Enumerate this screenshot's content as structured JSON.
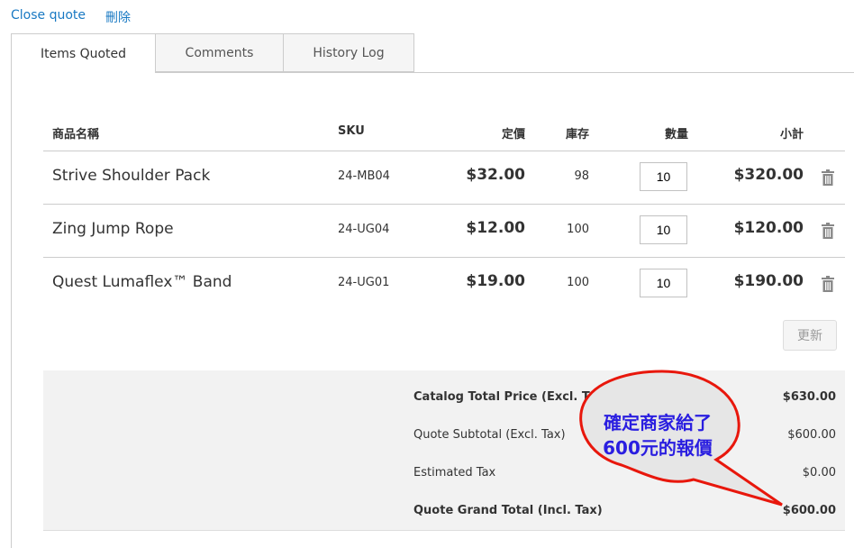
{
  "actions": {
    "close_quote": "Close quote",
    "delete": "刪除"
  },
  "tabs": [
    {
      "label": "Items Quoted",
      "active": true
    },
    {
      "label": "Comments"
    },
    {
      "label": "History Log"
    }
  ],
  "table": {
    "headers": [
      "商品名稱",
      "SKU",
      "定價",
      "庫存",
      "數量",
      "小計"
    ],
    "rows": [
      {
        "name": "Strive Shoulder Pack",
        "sku": "24-MB04",
        "price": "$32.00",
        "stock": "98",
        "qty": "10",
        "subtotal": "$320.00"
      },
      {
        "name": "Zing Jump Rope",
        "sku": "24-UG04",
        "price": "$12.00",
        "stock": "100",
        "qty": "10",
        "subtotal": "$120.00"
      },
      {
        "name": "Quest Lumaflex™ Band",
        "sku": "24-UG01",
        "price": "$19.00",
        "stock": "100",
        "qty": "10",
        "subtotal": "$190.00"
      }
    ],
    "update_label": "更新",
    "row_icon": "trash-icon"
  },
  "totals": [
    {
      "label": "Catalog Total Price (Excl. Tax)",
      "value": "$630.00",
      "bold": true
    },
    {
      "label": "Quote Subtotal (Excl. Tax)",
      "value": "$600.00"
    },
    {
      "label": "Estimated Tax",
      "value": "$0.00"
    },
    {
      "label": "Quote Grand Total (Incl. Tax)",
      "value": "$600.00",
      "bold": true
    }
  ],
  "callout": {
    "line1": "確定商家給了",
    "line2": "600元的報價",
    "text_color": "#2a1ee0",
    "border_color": "#e8170c"
  },
  "colors": {
    "link": "#1979c3",
    "totals_bg": "#f2f2f2"
  }
}
